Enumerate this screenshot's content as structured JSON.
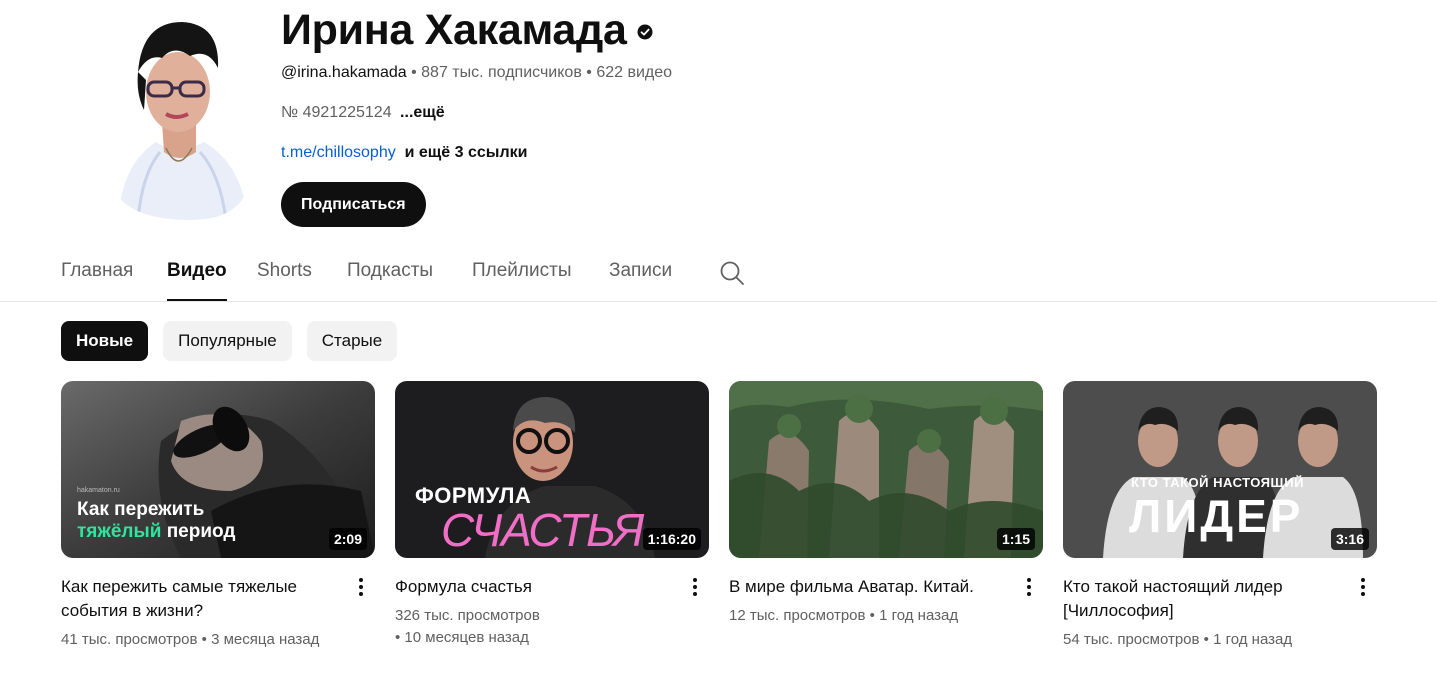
{
  "channel": {
    "title": "Ирина Хакамада",
    "handle": "@irina.hakamada",
    "subscribers": "887 тыс. подписчиков",
    "video_count": "622 видео",
    "description": "№ 4921225124",
    "description_more": "...ещё",
    "link": "t.me/chillosophy",
    "more_links": "и ещё 3 ссылки",
    "subscribe_label": "Подписаться"
  },
  "tabs": [
    {
      "label": "Главная"
    },
    {
      "label": "Видео"
    },
    {
      "label": "Shorts"
    },
    {
      "label": "Подкасты"
    },
    {
      "label": "Плейлисты"
    },
    {
      "label": "Записи"
    }
  ],
  "chips": [
    {
      "label": "Новые"
    },
    {
      "label": "Популярные"
    },
    {
      "label": "Старые"
    }
  ],
  "videos": [
    {
      "title": "Как пережить самые тяжелые события в жизни?",
      "meta": "41 тыс. просмотров • 3 месяца назад",
      "duration": "2:09",
      "thumb_text_1": "Как пережить",
      "thumb_text_2a": "тяжёлый",
      "thumb_text_2b": "период",
      "thumb_watermark": "hakamaton.ru"
    },
    {
      "title": "Формула счастья",
      "meta": "326 тыс. просмотров\n• 10 месяцев назад",
      "duration": "1:16:20",
      "thumb_text_1": "ФОРМУЛА",
      "thumb_text_2": "СЧАСТЬЯ"
    },
    {
      "title": "В мире фильма Аватар. Китай.",
      "meta": "12 тыс. просмотров • 1 год назад",
      "duration": "1:15"
    },
    {
      "title": "Кто такой настоящий лидер [Чиллософия]",
      "meta": "54 тыс. просмотров • 1 год назад",
      "duration": "3:16",
      "thumb_text_1": "КТО ТАКОЙ НАСТОЯЩИЙ",
      "thumb_text_2": "ЛИДЕР"
    }
  ],
  "icons": {
    "verified": "verified-check-icon",
    "search": "search-icon",
    "more": "more-vertical-icon"
  },
  "colors": {
    "text": "#0f0f0f",
    "secondary": "#606060",
    "link": "#065fd4",
    "accent_green": "#2ee59d",
    "accent_pink": "#f06fc6"
  }
}
